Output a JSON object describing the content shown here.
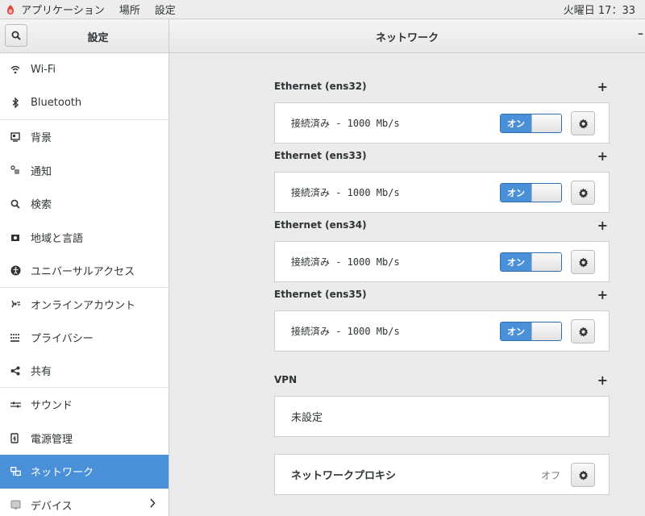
{
  "topbar": {
    "apps_label": "アプリケーション",
    "places_label": "場所",
    "settings_label": "設定",
    "clock": "火曜日 17：33"
  },
  "header": {
    "sidebar_title": "設定",
    "panel_title": "ネットワーク"
  },
  "sidebar": {
    "items": [
      {
        "label": "Wi-Fi",
        "icon": "wifi-icon"
      },
      {
        "label": "Bluetooth",
        "icon": "bluetooth-icon"
      },
      {
        "label": "背景",
        "icon": "background-icon"
      },
      {
        "label": "通知",
        "icon": "notification-icon"
      },
      {
        "label": "検索",
        "icon": "search-icon"
      },
      {
        "label": "地域と言語",
        "icon": "region-icon"
      },
      {
        "label": "ユニバーサルアクセス",
        "icon": "accessibility-icon"
      },
      {
        "label": "オンラインアカウント",
        "icon": "online-accounts-icon"
      },
      {
        "label": "プライバシー",
        "icon": "privacy-icon"
      },
      {
        "label": "共有",
        "icon": "share-icon"
      },
      {
        "label": "サウンド",
        "icon": "sound-icon"
      },
      {
        "label": "電源管理",
        "icon": "power-icon"
      },
      {
        "label": "ネットワーク",
        "icon": "network-icon"
      },
      {
        "label": "デバイス",
        "icon": "devices-icon"
      }
    ],
    "active_index": 12
  },
  "ethernet": [
    {
      "title": "Ethernet (ens32)",
      "status": "接続済み - 1000 Mb/s",
      "toggle_label": "オン"
    },
    {
      "title": "Ethernet (ens33)",
      "status": "接続済み - 1000 Mb/s",
      "toggle_label": "オン"
    },
    {
      "title": "Ethernet (ens34)",
      "status": "接続済み - 1000 Mb/s",
      "toggle_label": "オン"
    },
    {
      "title": "Ethernet (ens35)",
      "status": "接続済み - 1000 Mb/s",
      "toggle_label": "オン"
    }
  ],
  "vpn": {
    "title": "VPN",
    "status": "未設定"
  },
  "proxy": {
    "label": "ネットワークプロキシ",
    "state": "オフ"
  },
  "colors": {
    "accent": "#4a90d9"
  }
}
